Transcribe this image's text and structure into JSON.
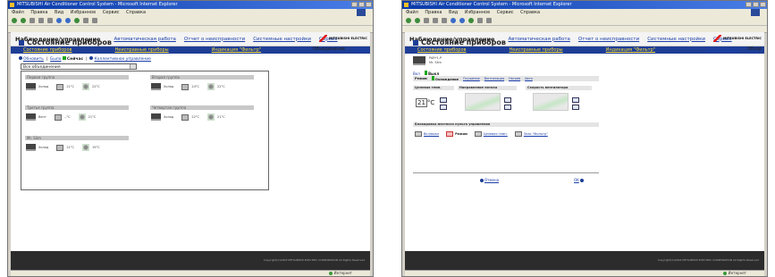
{
  "window1": {
    "title": "MITSUBISHI Air Conditioner Control System - Microsoft Internet Explorer",
    "menu": [
      "Файл",
      "Правка",
      "Вид",
      "Избранное",
      "Сервис",
      "Справка"
    ],
    "header": {
      "title": "Наблюдение/управление",
      "menu": [
        "Автоматическая работа",
        "Отчет о неисправности",
        "Системные настройки",
        "Сервис"
      ],
      "logo_text": "MITSUBISHI ELECTRIC"
    },
    "subnav": [
      "Состояние приборов",
      "Неисправные приборы",
      "Индикация \"Фильтр\""
    ],
    "page_title": "Состояние приборов",
    "overview": {
      "prefix": "Объединение",
      "link": "Обзор"
    },
    "controls": {
      "refresh": "Обновить",
      "sep": "|",
      "time_label": "Было",
      "now_label": "Сейчас",
      "bulk": "Коллективное управление"
    },
    "select_value": "Все объединения",
    "groups": [
      {
        "name": "Первая группа",
        "mode": "Холод",
        "set_temp": "21°C",
        "fan_temp": "22°C"
      },
      {
        "name": "Вторая группа",
        "mode": "Холод",
        "set_temp": "24°C",
        "fan_temp": "22°C"
      },
      {
        "name": "Третья группа",
        "mode": "Вент",
        "set_temp": "--°C",
        "fan_temp": "21°C"
      },
      {
        "name": "Четвертая группа",
        "mode": "Холод",
        "set_temp": "22°C",
        "fan_temp": "21°C"
      },
      {
        "name": "Mr. Slim",
        "mode": "Холод",
        "set_temp": "21°C",
        "fan_temp": "19°C"
      }
    ],
    "copyright": "Copyright(C)2003 MITSUBISHI ELECTRIC CORPORATION All Rights Reserved",
    "status_text": "Интернет"
  },
  "window2": {
    "title": "MITSUBISHI Air Conditioner Control System - Microsoft Internet Explorer",
    "menu": [
      "Файл",
      "Правка",
      "Вид",
      "Избранное",
      "Сервис",
      "Справка"
    ],
    "header": {
      "title": "Наблюдение/управление",
      "menu": [
        "Автоматическая работа",
        "Отчет о неисправности",
        "Системные настройки",
        "Сервис"
      ],
      "logo_text": "MITSUBISHI ELECTRIC"
    },
    "subnav": [
      "Состояние приборов",
      "Неисправные приборы",
      "Индикация \"Фильтр\""
    ],
    "page_title": "Состояние приборов",
    "overview": {
      "prefix": "Объединение",
      "link": "Обзор"
    },
    "unit": {
      "line1": "PAR*1-P",
      "line2": "Mr. Slim"
    },
    "onoff": {
      "on": "Вкл",
      "off": "Выкл"
    },
    "mode": {
      "label": "Режим",
      "items": [
        "Охлаждение",
        "Осушение",
        "Вентиляция",
        "Нагрев",
        "Авто"
      ]
    },
    "sections": {
      "temp": "Целевая темп.",
      "airflow": "Направление потока",
      "fan": "Скорость вентилятора"
    },
    "set_temp": "21",
    "temp_unit": "°C",
    "lock": {
      "title": "Блокировка местного пульта управления",
      "items": [
        "Вкл/выкл",
        "Режим",
        "Целевая темп.",
        "Знак \"Фильтр\""
      ]
    },
    "nav": {
      "back": "Отмена",
      "ok": "OK"
    },
    "copyright": "Copyright(C)2003 MITSUBISHI ELECTRIC CORPORATION All Rights Reserved",
    "status_text": "Интернет"
  },
  "colors": {
    "brand_blue": "#1e3e96",
    "link_yellow": "#ffdf3a",
    "active_green": "#1aa61a",
    "logo_red": "#e01a1a"
  }
}
